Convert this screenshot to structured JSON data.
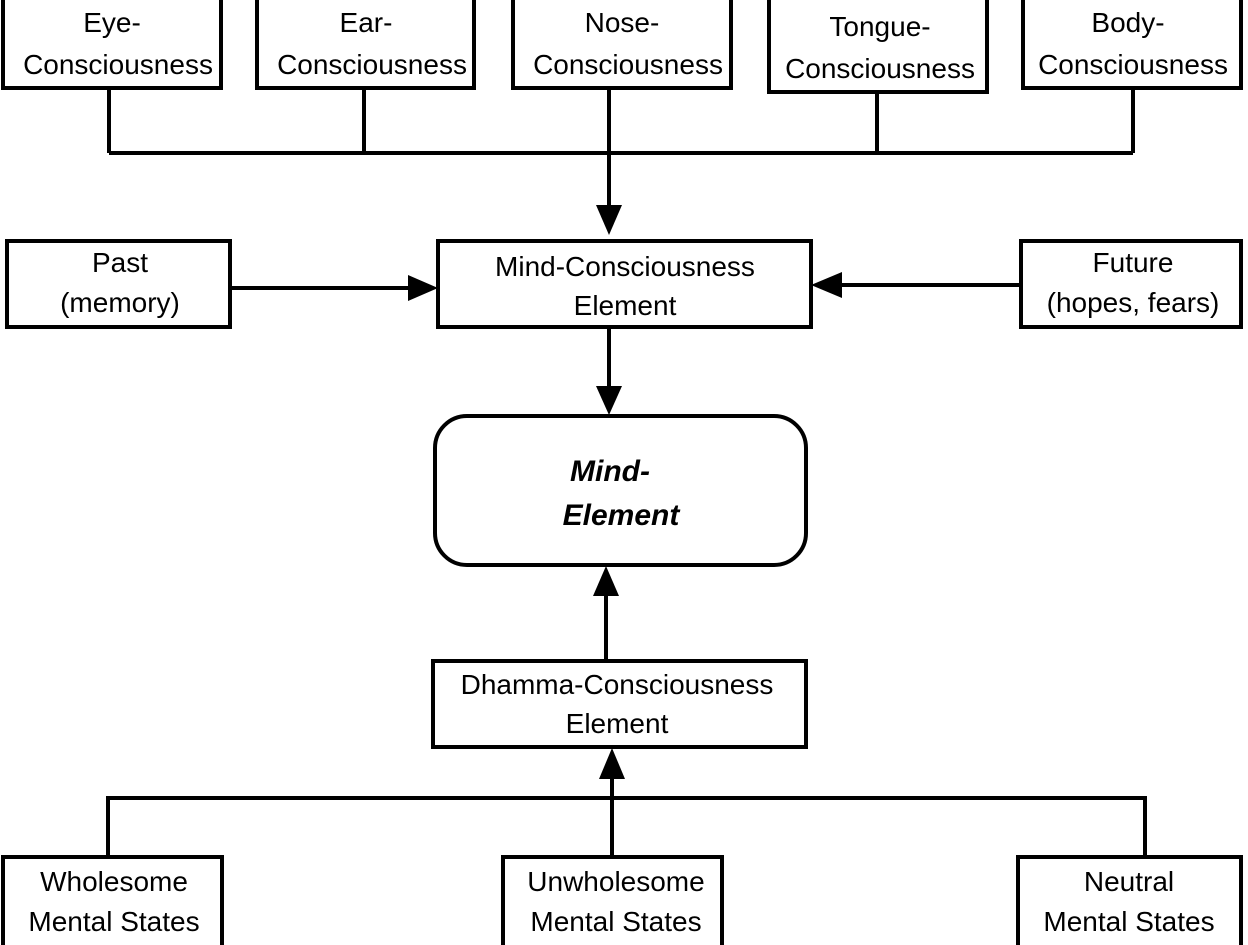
{
  "top_boxes": [
    {
      "line1": "Eye-",
      "line2": "Consciousness"
    },
    {
      "line1": "Ear-",
      "line2": "Consciousness"
    },
    {
      "line1": "Nose-",
      "line2": "Consciousness"
    },
    {
      "line1": "Tongue-",
      "line2": "Consciousness"
    },
    {
      "line1": "Body-",
      "line2": "Consciousness"
    }
  ],
  "past": {
    "line1": "Past",
    "line2": "(memory)"
  },
  "future": {
    "line1": "Future",
    "line2": "(hopes, fears)"
  },
  "mind_consciousness": {
    "line1": "Mind-Consciousness",
    "line2": "Element"
  },
  "mind_element": {
    "line1": "Mind-",
    "line2": "Element"
  },
  "dhamma_consciousness": {
    "line1": "Dhamma-Consciousness",
    "line2": "Element"
  },
  "bottom_boxes": [
    {
      "line1": "Wholesome",
      "line2": "Mental States"
    },
    {
      "line1": "Unwholesome",
      "line2": "Mental States"
    },
    {
      "line1": "Neutral",
      "line2": "Mental States"
    }
  ]
}
